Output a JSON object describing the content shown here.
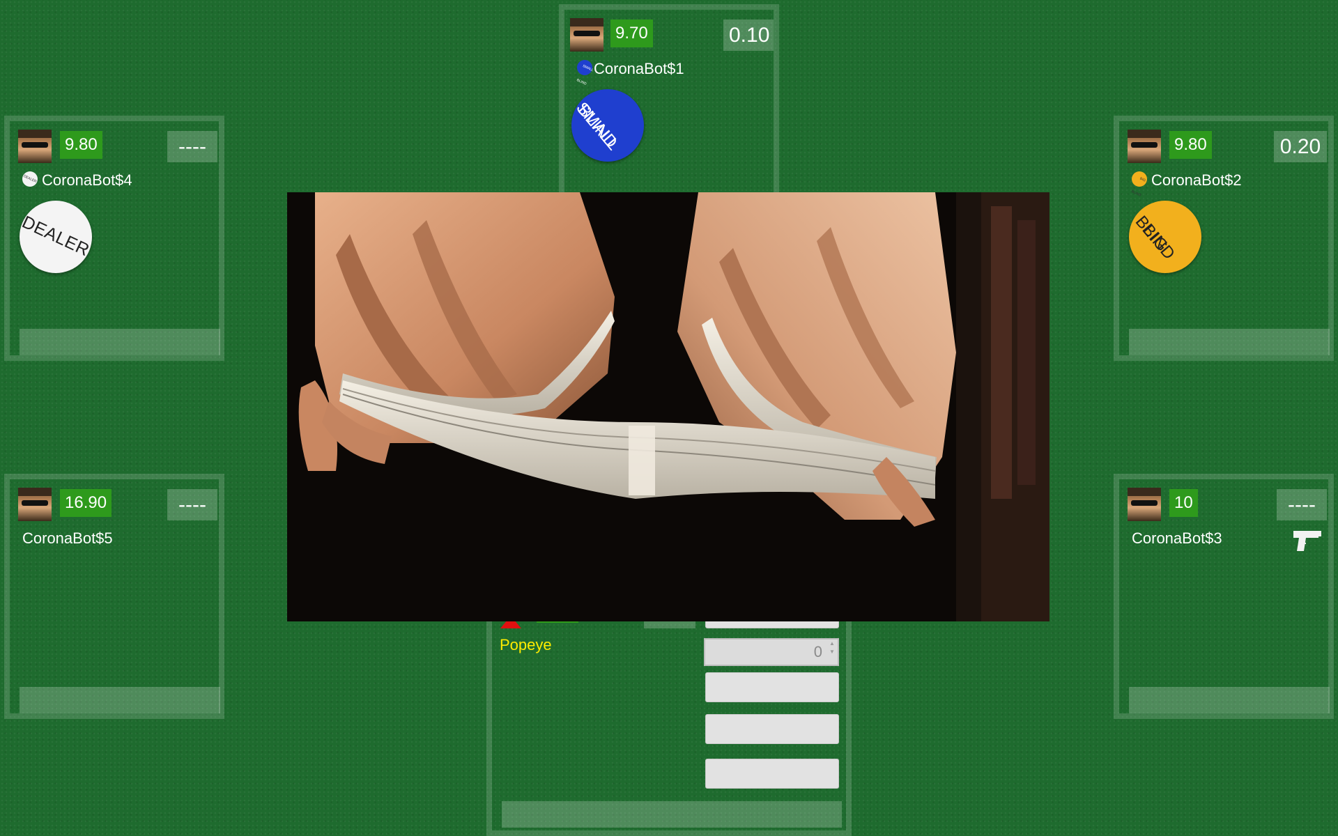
{
  "seats": [
    {
      "id": "seat-1",
      "name": "CoronaBot$1",
      "stack": "9.70",
      "bet": "0.10",
      "badge": "small-blind",
      "badge_label": [
        "SMALL",
        "BLIND"
      ],
      "mini_badge_label": "SMALL BLIND"
    },
    {
      "id": "seat-2",
      "name": "CoronaBot$2",
      "stack": "9.80",
      "bet": "0.20",
      "badge": "big-blind",
      "badge_label": [
        "BIG",
        "BLIND"
      ],
      "mini_badge_label": "BIG BLIND"
    },
    {
      "id": "seat-3",
      "name": "CoronaBot$3",
      "stack": "10",
      "bet": "----",
      "icon": "pistol-icon"
    },
    {
      "id": "seat-4",
      "name": "CoronaBot$4",
      "stack": "9.80",
      "bet": "----",
      "badge": "dealer",
      "badge_label": [
        "DEALER"
      ],
      "mini_badge_label": "DEALER"
    },
    {
      "id": "seat-5",
      "name": "CoronaBot$5",
      "stack": "16.90",
      "bet": "----"
    }
  ],
  "hero": {
    "name": "Popeye",
    "bet_amount": "0"
  },
  "colors": {
    "felt": "#1e6b2e",
    "stack_bg": "#2e9a1c",
    "small_blind": "#1f3fcf",
    "big_blind": "#f2b01d",
    "dealer": "#f4f4f4",
    "hero_name": "#ffec00",
    "hero_marker": "#e01010"
  },
  "overlay": {
    "type": "animation",
    "subject": "card-shuffle"
  }
}
